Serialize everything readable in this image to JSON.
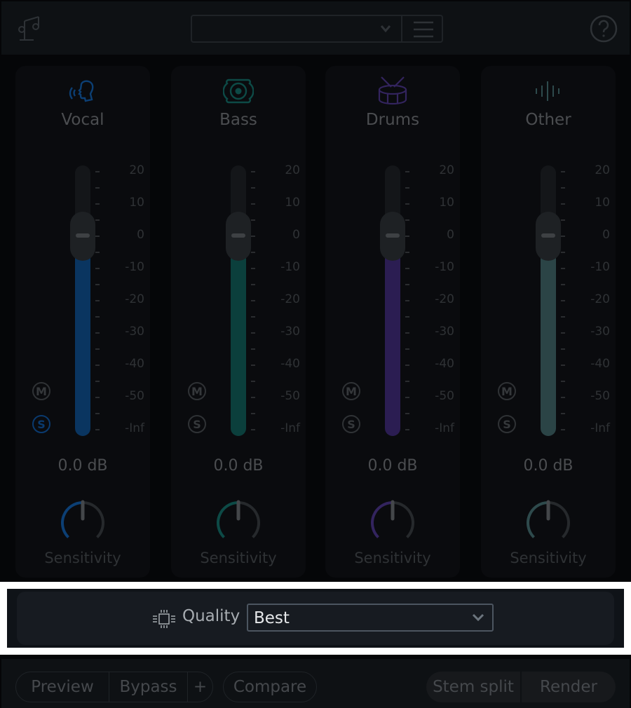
{
  "header": {
    "logo_icon": "music-notes-icon",
    "preset": {
      "value": "",
      "chevron_icon": "chevron-down-icon",
      "menu_icon": "hamburger-menu-icon"
    },
    "help_icon": "help-question-icon"
  },
  "channels": [
    {
      "name": "Vocal",
      "icon": "vocal-head-icon",
      "color": "#0a3560",
      "fader_db": 0.0,
      "db_label": "0.0 dB",
      "mute": false,
      "solo": true,
      "sensitivity": 0.5,
      "sensitivity_label": "Sensitivity",
      "mute_label": "M",
      "solo_label": "S"
    },
    {
      "name": "Bass",
      "icon": "speaker-icon",
      "color": "#0b3f3c",
      "fader_db": 0.0,
      "db_label": "0.0 dB",
      "mute": false,
      "solo": false,
      "sensitivity": 0.5,
      "sensitivity_label": "Sensitivity",
      "mute_label": "M",
      "solo_label": "S"
    },
    {
      "name": "Drums",
      "icon": "drum-icon",
      "color": "#2b1d52",
      "fader_db": 0.0,
      "db_label": "0.0 dB",
      "mute": false,
      "solo": false,
      "sensitivity": 0.5,
      "sensitivity_label": "Sensitivity",
      "mute_label": "M",
      "solo_label": "S"
    },
    {
      "name": "Other",
      "icon": "waveform-icon",
      "color": "#2b4446",
      "fader_db": 0.0,
      "db_label": "0.0 dB",
      "mute": false,
      "solo": false,
      "sensitivity": 0.5,
      "sensitivity_label": "Sensitivity",
      "mute_label": "M",
      "solo_label": "S"
    }
  ],
  "fader_scale": [
    "20",
    "10",
    "0",
    "-10",
    "-20",
    "-30",
    "-40",
    "-50",
    "-Inf"
  ],
  "quality": {
    "icon": "cpu-chip-icon",
    "label": "Quality",
    "value": "Best",
    "chevron_icon": "chevron-down-icon"
  },
  "footer": {
    "preview": "Preview",
    "bypass": "Bypass",
    "plus": "+",
    "compare": "Compare",
    "stem_split": "Stem split",
    "render": "Render"
  },
  "colors": {
    "solo_active": "#0a3a6e",
    "inactive": "#2f3235",
    "text_dim": "#4b4d50"
  }
}
